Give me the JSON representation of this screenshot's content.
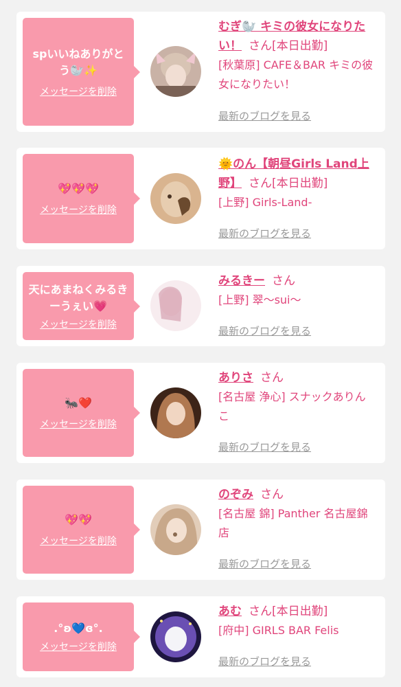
{
  "items": [
    {
      "message": "spいいねありがとう🦭✨",
      "delete_label": "メッセージを削除",
      "name": "むぎ🦭 キミの彼女になりたい！",
      "san": "さん",
      "status": "[本日出勤]",
      "shop": "[秋葉原] CAFE＆BAR キミの彼女になりたい！",
      "blog_label": "最新のブログを見る",
      "avatar_colors": [
        "#c9b2a6",
        "#7a6256"
      ]
    },
    {
      "message": "💖💖💖",
      "delete_label": "メッセージを削除",
      "name": "🌞のん【朝昼Girls Land上野】",
      "san": "さん",
      "status": "[本日出勤]",
      "shop": "[上野] Girls-Land-",
      "blog_label": "最新のブログを見る",
      "avatar_colors": [
        "#d9b48f",
        "#6b4a2e"
      ]
    },
    {
      "message": "天にあまねくみるきーうぇい💗",
      "delete_label": "メッセージを削除",
      "name": "みるきー",
      "san": "さん",
      "status": "",
      "shop": "[上野] 翠〜sui〜",
      "blog_label": "最新のブログを見る",
      "avatar_colors": [
        "#f3d9de",
        "#d6a3b2"
      ]
    },
    {
      "message": "🐜❤️",
      "delete_label": "メッセージを削除",
      "name": "ありさ",
      "san": "さん",
      "status": "",
      "shop": "[名古屋 浄心] スナックありんこ",
      "blog_label": "最新のブログを見る",
      "avatar_colors": [
        "#b07850",
        "#3d2418"
      ]
    },
    {
      "message": "💖💖",
      "delete_label": "メッセージを削除",
      "name": "のぞみ",
      "san": "さん",
      "status": "",
      "shop": "[名古屋 錦] Panther 名古屋錦店",
      "blog_label": "最新のブログを見る",
      "avatar_colors": [
        "#e2cdb9",
        "#8a6a50"
      ]
    },
    {
      "message": ".°ʚ💙ɞ°.",
      "delete_label": "メッセージを削除",
      "name": "あむ",
      "san": "さん",
      "status": "[本日出勤]",
      "shop": "[府中] GIRLS BAR Felis",
      "blog_label": "最新のブログを見る",
      "avatar_colors": [
        "#6a4fb3",
        "#1e1640"
      ]
    }
  ],
  "colors": {
    "accent": "#e0457b",
    "bubble": "#f99aac",
    "background": "#f2f2f2",
    "link_gray": "#999999"
  }
}
